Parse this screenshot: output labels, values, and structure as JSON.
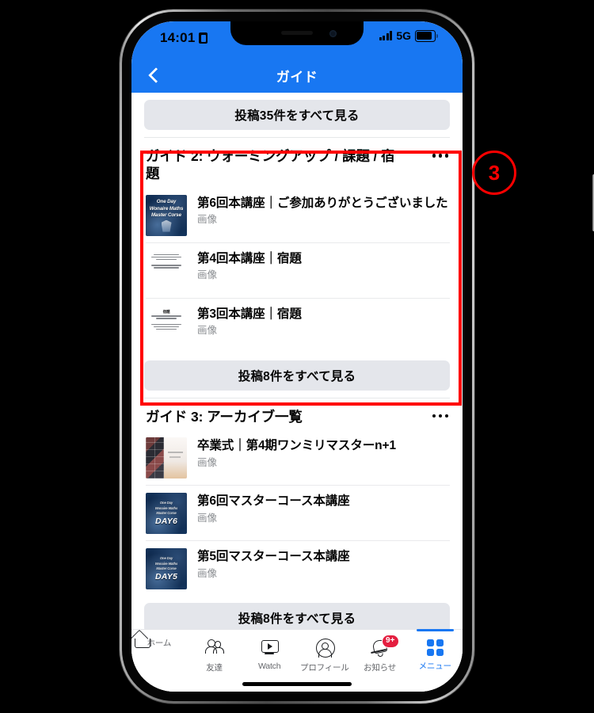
{
  "status_bar": {
    "time": "14:01",
    "lock_icon": "lock-icon",
    "signal_icon": "signal-bars-icon",
    "network": "5G",
    "battery_icon": "battery-icon"
  },
  "nav": {
    "back_icon": "chevron-left-icon",
    "title": "ガイド"
  },
  "top_see_all": {
    "label": "投稿35件をすべて見る"
  },
  "sections": [
    {
      "title": "ガイド 2: ウォーミングアップ / 課題 / 宿題",
      "menu_icon": "more-options-icon",
      "items": [
        {
          "title": "第6回本講座｜ご参加ありがとうございました",
          "subtitle": "画像",
          "thumb_type": "course-navy",
          "thumb_text": [
            "One Day",
            "Wonaire Maths",
            "Master Corse"
          ],
          "thumb_day": ""
        },
        {
          "title": "第4回本講座｜宿題",
          "subtitle": "画像",
          "thumb_type": "doc-white",
          "thumb_text": [],
          "thumb_day": ""
        },
        {
          "title": "第3回本講座｜宿題",
          "subtitle": "画像",
          "thumb_type": "doc-white-heading",
          "thumb_text": [
            "宿題"
          ],
          "thumb_day": ""
        }
      ],
      "see_all_label": "投稿8件をすべて見る"
    },
    {
      "title": "ガイド 3: アーカイブ一覧",
      "menu_icon": "more-options-icon",
      "items": [
        {
          "title": "卒業式｜第4期ワンミリマスターn+1",
          "subtitle": "画像",
          "thumb_type": "graduation-photo",
          "thumb_text": [],
          "thumb_day": ""
        },
        {
          "title": "第6回マスターコース本講座",
          "subtitle": "画像",
          "thumb_type": "course-navy",
          "thumb_text": [
            "One Day",
            "Wonaire Maths",
            "Master Corse"
          ],
          "thumb_day": "DAY6"
        },
        {
          "title": "第5回マスターコース本講座",
          "subtitle": "画像",
          "thumb_type": "course-navy",
          "thumb_text": [
            "One Day",
            "Wonaire Maths",
            "Master Corse"
          ],
          "thumb_day": "DAY5"
        }
      ],
      "see_all_label": "投稿8件をすべて見る"
    }
  ],
  "tabbar": {
    "items": [
      {
        "label": "ホーム",
        "icon": "home-icon",
        "active": false,
        "badge": ""
      },
      {
        "label": "友達",
        "icon": "friends-icon",
        "active": false,
        "badge": ""
      },
      {
        "label": "Watch",
        "icon": "watch-icon",
        "active": false,
        "badge": ""
      },
      {
        "label": "プロフィール",
        "icon": "profile-icon",
        "active": false,
        "badge": ""
      },
      {
        "label": "お知らせ",
        "icon": "bell-icon",
        "active": false,
        "badge": "9+"
      },
      {
        "label": "メニュー",
        "icon": "menu-grid-icon",
        "active": true,
        "badge": ""
      }
    ]
  },
  "annotations": {
    "step_number": "③",
    "step_number_text": "3",
    "highlight_color": "#ff0000"
  },
  "colors": {
    "brand_blue": "#1877f2",
    "button_grey": "#e4e6eb",
    "text_primary": "#050505",
    "text_secondary": "#8a8d91",
    "badge_red": "#e41e3f"
  }
}
